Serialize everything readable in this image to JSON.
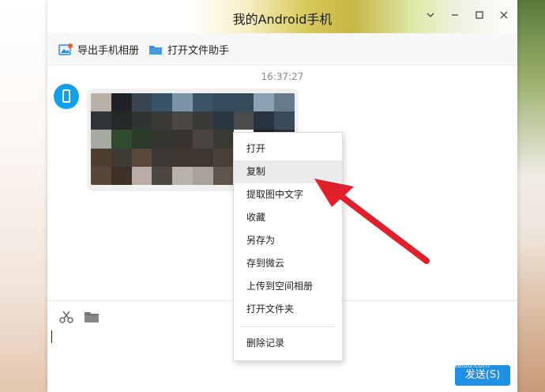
{
  "window": {
    "title": "我的Android手机",
    "controls": [
      "chevron-down-icon",
      "minimize-icon",
      "maximize-icon",
      "close-icon"
    ]
  },
  "toolbar": {
    "export_album_label": "导出手机相册",
    "open_file_assistant_label": "打开文件助手"
  },
  "chat": {
    "timestamp": "16:37:27",
    "message_type": "image"
  },
  "context_menu": {
    "items": [
      {
        "label": "打开"
      },
      {
        "label": "复制",
        "highlighted": true
      },
      {
        "label": "提取图中文字"
      },
      {
        "label": "收藏"
      },
      {
        "label": "另存为"
      },
      {
        "label": "存到微云"
      },
      {
        "label": "上传到空间相册"
      },
      {
        "label": "打开文件夹"
      },
      {
        "label": "删除记录"
      }
    ]
  },
  "input": {
    "tools": [
      "scissors-icon",
      "folder-icon"
    ],
    "send_label": "发送(S)"
  },
  "watermark": {
    "text": "Baidu 经验",
    "sub": "jingyan.baidu.com"
  },
  "colors": {
    "accent": "#1e90e6",
    "avatar": "#12a0ea",
    "arrow": "#e0202a"
  },
  "mosaic_colors": [
    "#b9b0aa",
    "#1f2226",
    "#3a4550",
    "#365466",
    "#7c95a6",
    "#3c5566",
    "#354b5a",
    "#354b5a",
    "#8aa2b4",
    "#667a88",
    "#2e3438",
    "#242a26",
    "#2f3432",
    "#3c3a36",
    "#4a4642",
    "#3a3a36",
    "#2a3640",
    "#4a4c4c",
    "#283440",
    "#3a4a58",
    "#a7aaa2",
    "#2f4a2e",
    "#2c3a2a",
    "#34362e",
    "#3a3430",
    "#4a4440",
    "#3a3a34",
    "#ffffff",
    "#1f2226",
    "#2a3036",
    "#4e3e32",
    "#3e3a34",
    "#5a4a3e",
    "#3e3834",
    "#403830",
    "#3e3630",
    "#4a403a",
    "#f2f2f2",
    "#2c2c2c",
    "#383838",
    "#5a4636",
    "#3c3228",
    "#b8aea6",
    "#4c4640",
    "#b8b2ac",
    "#a8a29c",
    "#5c564e",
    "#ffffff",
    "#3a3a3a",
    "#e6e6e6"
  ]
}
